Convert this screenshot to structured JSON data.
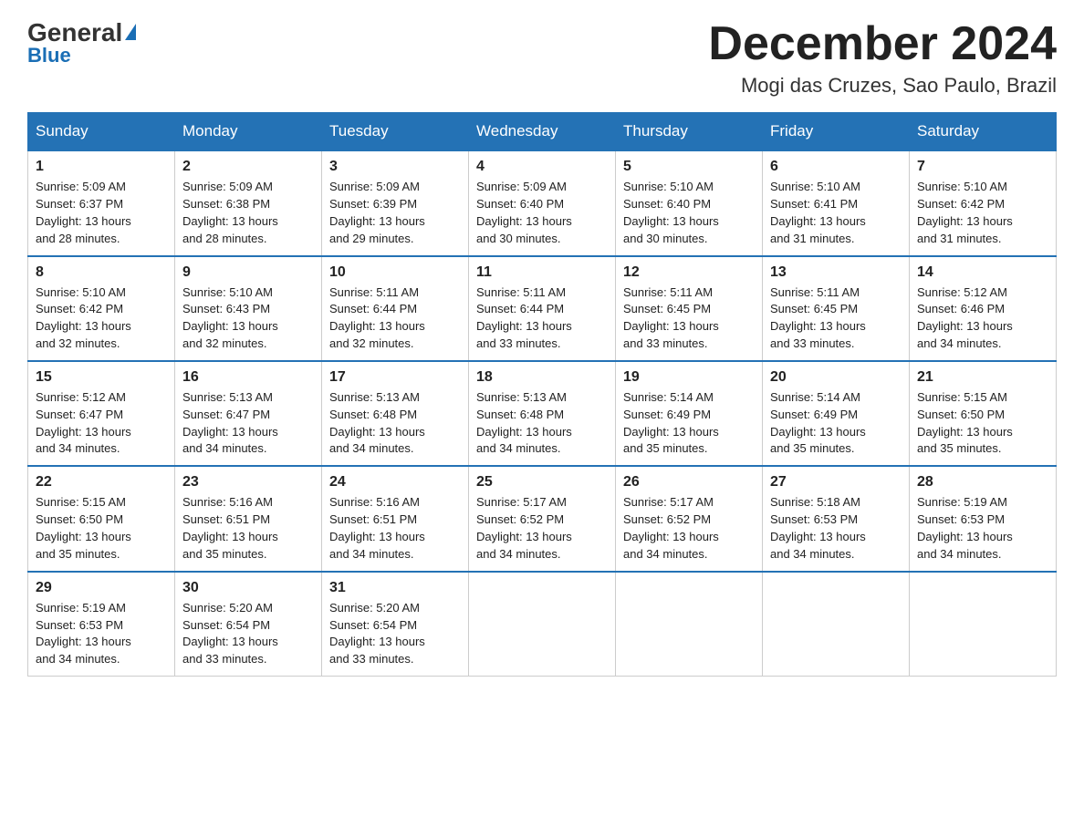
{
  "header": {
    "logo_general": "General",
    "logo_blue": "Blue",
    "month_title": "December 2024",
    "location": "Mogi das Cruzes, Sao Paulo, Brazil"
  },
  "weekdays": [
    "Sunday",
    "Monday",
    "Tuesday",
    "Wednesday",
    "Thursday",
    "Friday",
    "Saturday"
  ],
  "weeks": [
    [
      {
        "day": "1",
        "sunrise": "5:09 AM",
        "sunset": "6:37 PM",
        "daylight": "13 hours and 28 minutes."
      },
      {
        "day": "2",
        "sunrise": "5:09 AM",
        "sunset": "6:38 PM",
        "daylight": "13 hours and 28 minutes."
      },
      {
        "day": "3",
        "sunrise": "5:09 AM",
        "sunset": "6:39 PM",
        "daylight": "13 hours and 29 minutes."
      },
      {
        "day": "4",
        "sunrise": "5:09 AM",
        "sunset": "6:40 PM",
        "daylight": "13 hours and 30 minutes."
      },
      {
        "day": "5",
        "sunrise": "5:10 AM",
        "sunset": "6:40 PM",
        "daylight": "13 hours and 30 minutes."
      },
      {
        "day": "6",
        "sunrise": "5:10 AM",
        "sunset": "6:41 PM",
        "daylight": "13 hours and 31 minutes."
      },
      {
        "day": "7",
        "sunrise": "5:10 AM",
        "sunset": "6:42 PM",
        "daylight": "13 hours and 31 minutes."
      }
    ],
    [
      {
        "day": "8",
        "sunrise": "5:10 AM",
        "sunset": "6:42 PM",
        "daylight": "13 hours and 32 minutes."
      },
      {
        "day": "9",
        "sunrise": "5:10 AM",
        "sunset": "6:43 PM",
        "daylight": "13 hours and 32 minutes."
      },
      {
        "day": "10",
        "sunrise": "5:11 AM",
        "sunset": "6:44 PM",
        "daylight": "13 hours and 32 minutes."
      },
      {
        "day": "11",
        "sunrise": "5:11 AM",
        "sunset": "6:44 PM",
        "daylight": "13 hours and 33 minutes."
      },
      {
        "day": "12",
        "sunrise": "5:11 AM",
        "sunset": "6:45 PM",
        "daylight": "13 hours and 33 minutes."
      },
      {
        "day": "13",
        "sunrise": "5:11 AM",
        "sunset": "6:45 PM",
        "daylight": "13 hours and 33 minutes."
      },
      {
        "day": "14",
        "sunrise": "5:12 AM",
        "sunset": "6:46 PM",
        "daylight": "13 hours and 34 minutes."
      }
    ],
    [
      {
        "day": "15",
        "sunrise": "5:12 AM",
        "sunset": "6:47 PM",
        "daylight": "13 hours and 34 minutes."
      },
      {
        "day": "16",
        "sunrise": "5:13 AM",
        "sunset": "6:47 PM",
        "daylight": "13 hours and 34 minutes."
      },
      {
        "day": "17",
        "sunrise": "5:13 AM",
        "sunset": "6:48 PM",
        "daylight": "13 hours and 34 minutes."
      },
      {
        "day": "18",
        "sunrise": "5:13 AM",
        "sunset": "6:48 PM",
        "daylight": "13 hours and 34 minutes."
      },
      {
        "day": "19",
        "sunrise": "5:14 AM",
        "sunset": "6:49 PM",
        "daylight": "13 hours and 35 minutes."
      },
      {
        "day": "20",
        "sunrise": "5:14 AM",
        "sunset": "6:49 PM",
        "daylight": "13 hours and 35 minutes."
      },
      {
        "day": "21",
        "sunrise": "5:15 AM",
        "sunset": "6:50 PM",
        "daylight": "13 hours and 35 minutes."
      }
    ],
    [
      {
        "day": "22",
        "sunrise": "5:15 AM",
        "sunset": "6:50 PM",
        "daylight": "13 hours and 35 minutes."
      },
      {
        "day": "23",
        "sunrise": "5:16 AM",
        "sunset": "6:51 PM",
        "daylight": "13 hours and 35 minutes."
      },
      {
        "day": "24",
        "sunrise": "5:16 AM",
        "sunset": "6:51 PM",
        "daylight": "13 hours and 34 minutes."
      },
      {
        "day": "25",
        "sunrise": "5:17 AM",
        "sunset": "6:52 PM",
        "daylight": "13 hours and 34 minutes."
      },
      {
        "day": "26",
        "sunrise": "5:17 AM",
        "sunset": "6:52 PM",
        "daylight": "13 hours and 34 minutes."
      },
      {
        "day": "27",
        "sunrise": "5:18 AM",
        "sunset": "6:53 PM",
        "daylight": "13 hours and 34 minutes."
      },
      {
        "day": "28",
        "sunrise": "5:19 AM",
        "sunset": "6:53 PM",
        "daylight": "13 hours and 34 minutes."
      }
    ],
    [
      {
        "day": "29",
        "sunrise": "5:19 AM",
        "sunset": "6:53 PM",
        "daylight": "13 hours and 34 minutes."
      },
      {
        "day": "30",
        "sunrise": "5:20 AM",
        "sunset": "6:54 PM",
        "daylight": "13 hours and 33 minutes."
      },
      {
        "day": "31",
        "sunrise": "5:20 AM",
        "sunset": "6:54 PM",
        "daylight": "13 hours and 33 minutes."
      },
      null,
      null,
      null,
      null
    ]
  ],
  "labels": {
    "sunrise": "Sunrise:",
    "sunset": "Sunset:",
    "daylight": "Daylight:"
  }
}
